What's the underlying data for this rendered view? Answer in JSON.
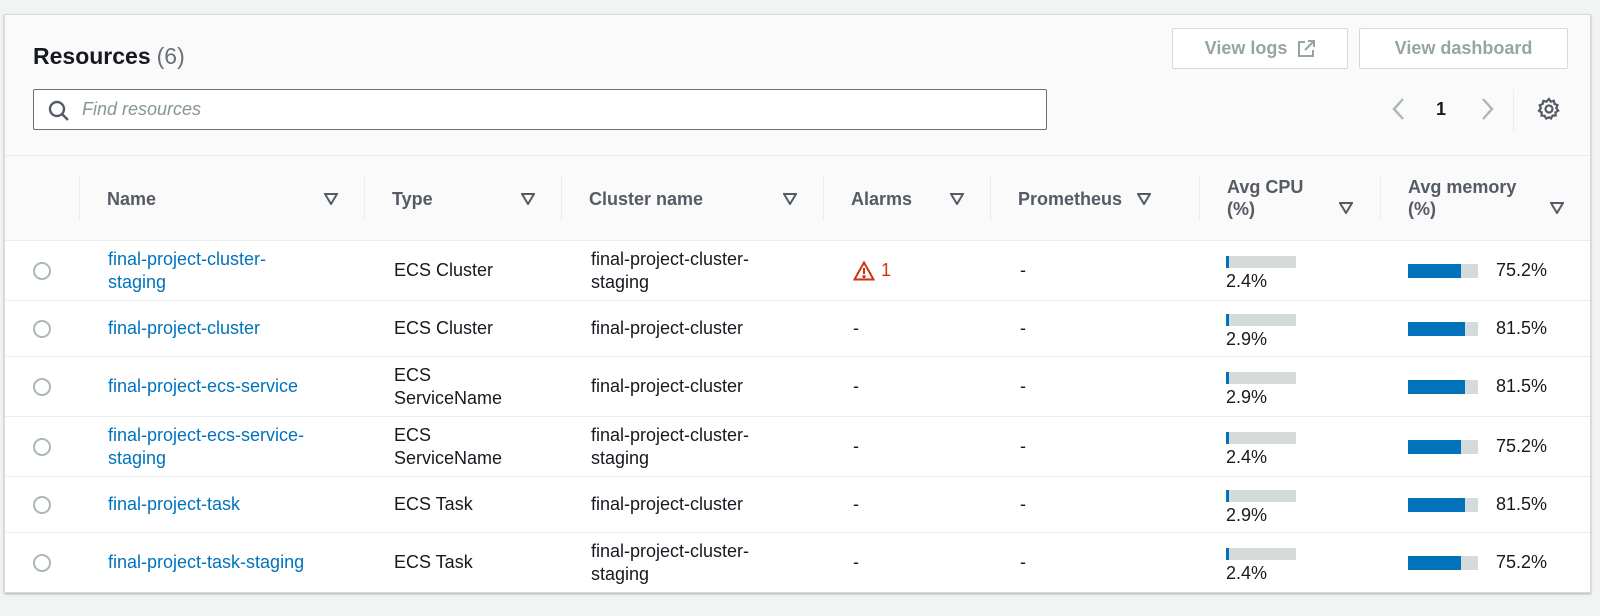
{
  "header": {
    "title": "Resources",
    "count": "(6)",
    "view_logs_label": "View logs",
    "view_dashboard_label": "View dashboard"
  },
  "search": {
    "placeholder": "Find resources",
    "value": ""
  },
  "pagination": {
    "current_page": "1"
  },
  "columns": {
    "name": "Name",
    "type": "Type",
    "cluster": "Cluster name",
    "alarms": "Alarms",
    "prometheus": "Prometheus",
    "cpu_line1": "Avg CPU",
    "cpu_line2": "(%)",
    "mem_line1": "Avg memory",
    "mem_line2": "(%)"
  },
  "rows": [
    {
      "name1": "final-project-cluster-",
      "name2": "staging",
      "type1": "ECS Cluster",
      "type2": "",
      "cluster1": "final-project-cluster-",
      "cluster2": "staging",
      "alarms": "1",
      "alarm_state": true,
      "prometheus": "-",
      "cpu": "2.4%",
      "cpu_fraction": 0.024,
      "mem": "75.2%",
      "mem_fraction": 0.752
    },
    {
      "name1": "final-project-cluster",
      "name2": "",
      "type1": "ECS Cluster",
      "type2": "",
      "cluster1": "final-project-cluster",
      "cluster2": "",
      "alarms": "-",
      "alarm_state": false,
      "prometheus": "-",
      "cpu": "2.9%",
      "cpu_fraction": 0.029,
      "mem": "81.5%",
      "mem_fraction": 0.815
    },
    {
      "name1": "final-project-ecs-service",
      "name2": "",
      "type1": "ECS",
      "type2": "ServiceName",
      "cluster1": "final-project-cluster",
      "cluster2": "",
      "alarms": "-",
      "alarm_state": false,
      "prometheus": "-",
      "cpu": "2.9%",
      "cpu_fraction": 0.029,
      "mem": "81.5%",
      "mem_fraction": 0.815
    },
    {
      "name1": "final-project-ecs-service-",
      "name2": "staging",
      "type1": "ECS",
      "type2": "ServiceName",
      "cluster1": "final-project-cluster-",
      "cluster2": "staging",
      "alarms": "-",
      "alarm_state": false,
      "prometheus": "-",
      "cpu": "2.4%",
      "cpu_fraction": 0.024,
      "mem": "75.2%",
      "mem_fraction": 0.752
    },
    {
      "name1": "final-project-task",
      "name2": "",
      "type1": "ECS Task",
      "type2": "",
      "cluster1": "final-project-cluster",
      "cluster2": "",
      "alarms": "-",
      "alarm_state": false,
      "prometheus": "-",
      "cpu": "2.9%",
      "cpu_fraction": 0.029,
      "mem": "81.5%",
      "mem_fraction": 0.815
    },
    {
      "name1": "final-project-task-staging",
      "name2": "",
      "type1": "ECS Task",
      "type2": "",
      "cluster1": "final-project-cluster-",
      "cluster2": "staging",
      "alarms": "-",
      "alarm_state": false,
      "prometheus": "-",
      "cpu": "2.4%",
      "cpu_fraction": 0.024,
      "mem": "75.2%",
      "mem_fraction": 0.752
    }
  ],
  "colors": {
    "link": "#0073bb",
    "alarm": "#d13212",
    "bar_fill": "#0073bb",
    "bar_track": "#d5dbdb"
  },
  "icons": {
    "search": "search-icon",
    "external": "external-link-icon",
    "prev": "chevron-left-icon",
    "next": "chevron-right-icon",
    "settings": "gear-icon",
    "sort": "sort-caret-icon",
    "alarm": "warning-icon"
  }
}
